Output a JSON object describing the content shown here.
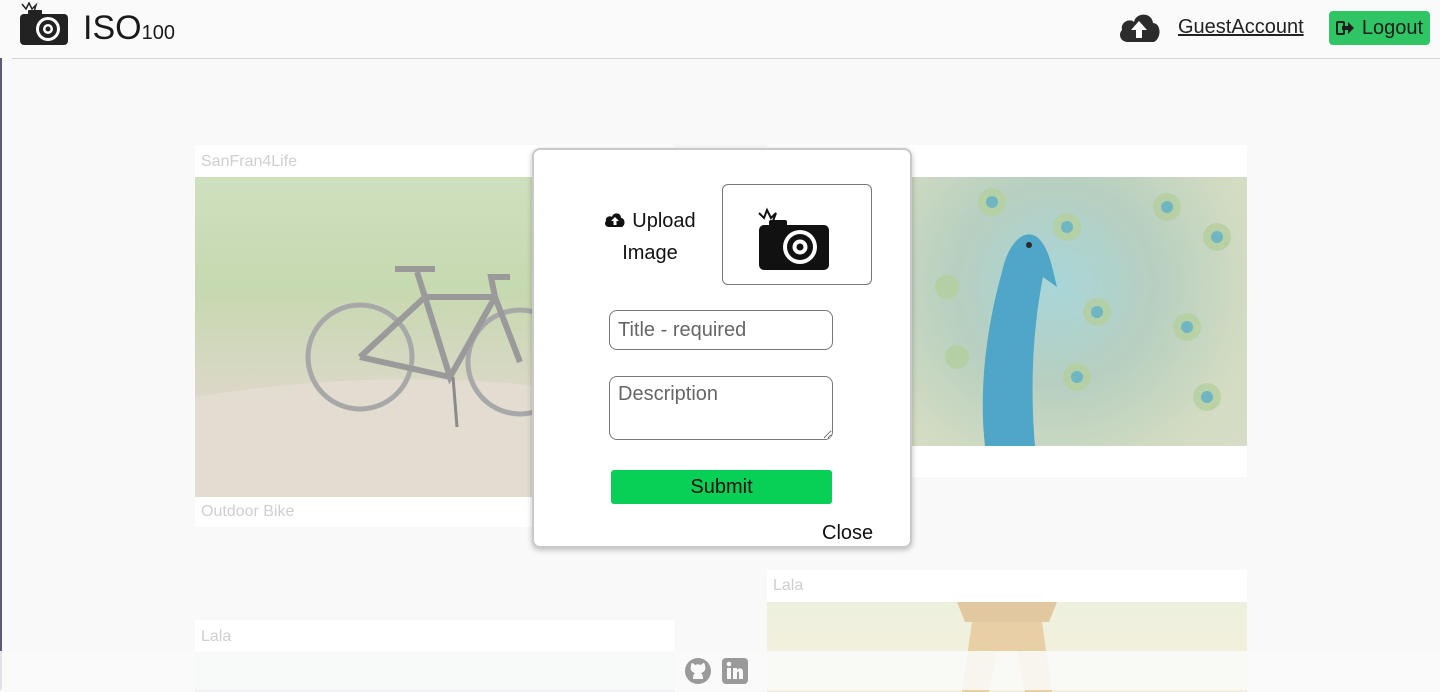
{
  "header": {
    "brand_main": "ISO",
    "brand_sub": "100",
    "user_link": "GuestAccount",
    "logout_label": "Logout"
  },
  "feed": {
    "cards": [
      {
        "owner": "SanFran4Life",
        "title": "Outdoor Bike"
      },
      {
        "owner": "",
        "title": ""
      },
      {
        "owner": "Lala",
        "title": ""
      },
      {
        "owner": "Lala",
        "title": ""
      }
    ]
  },
  "modal": {
    "upload_label": "Upload Image",
    "title_placeholder": "Title - required",
    "description_placeholder": "Description",
    "submit_label": "Submit",
    "close_label": "Close"
  },
  "colors": {
    "logout_bg": "#2fc565",
    "submit_bg": "#08cf56"
  }
}
